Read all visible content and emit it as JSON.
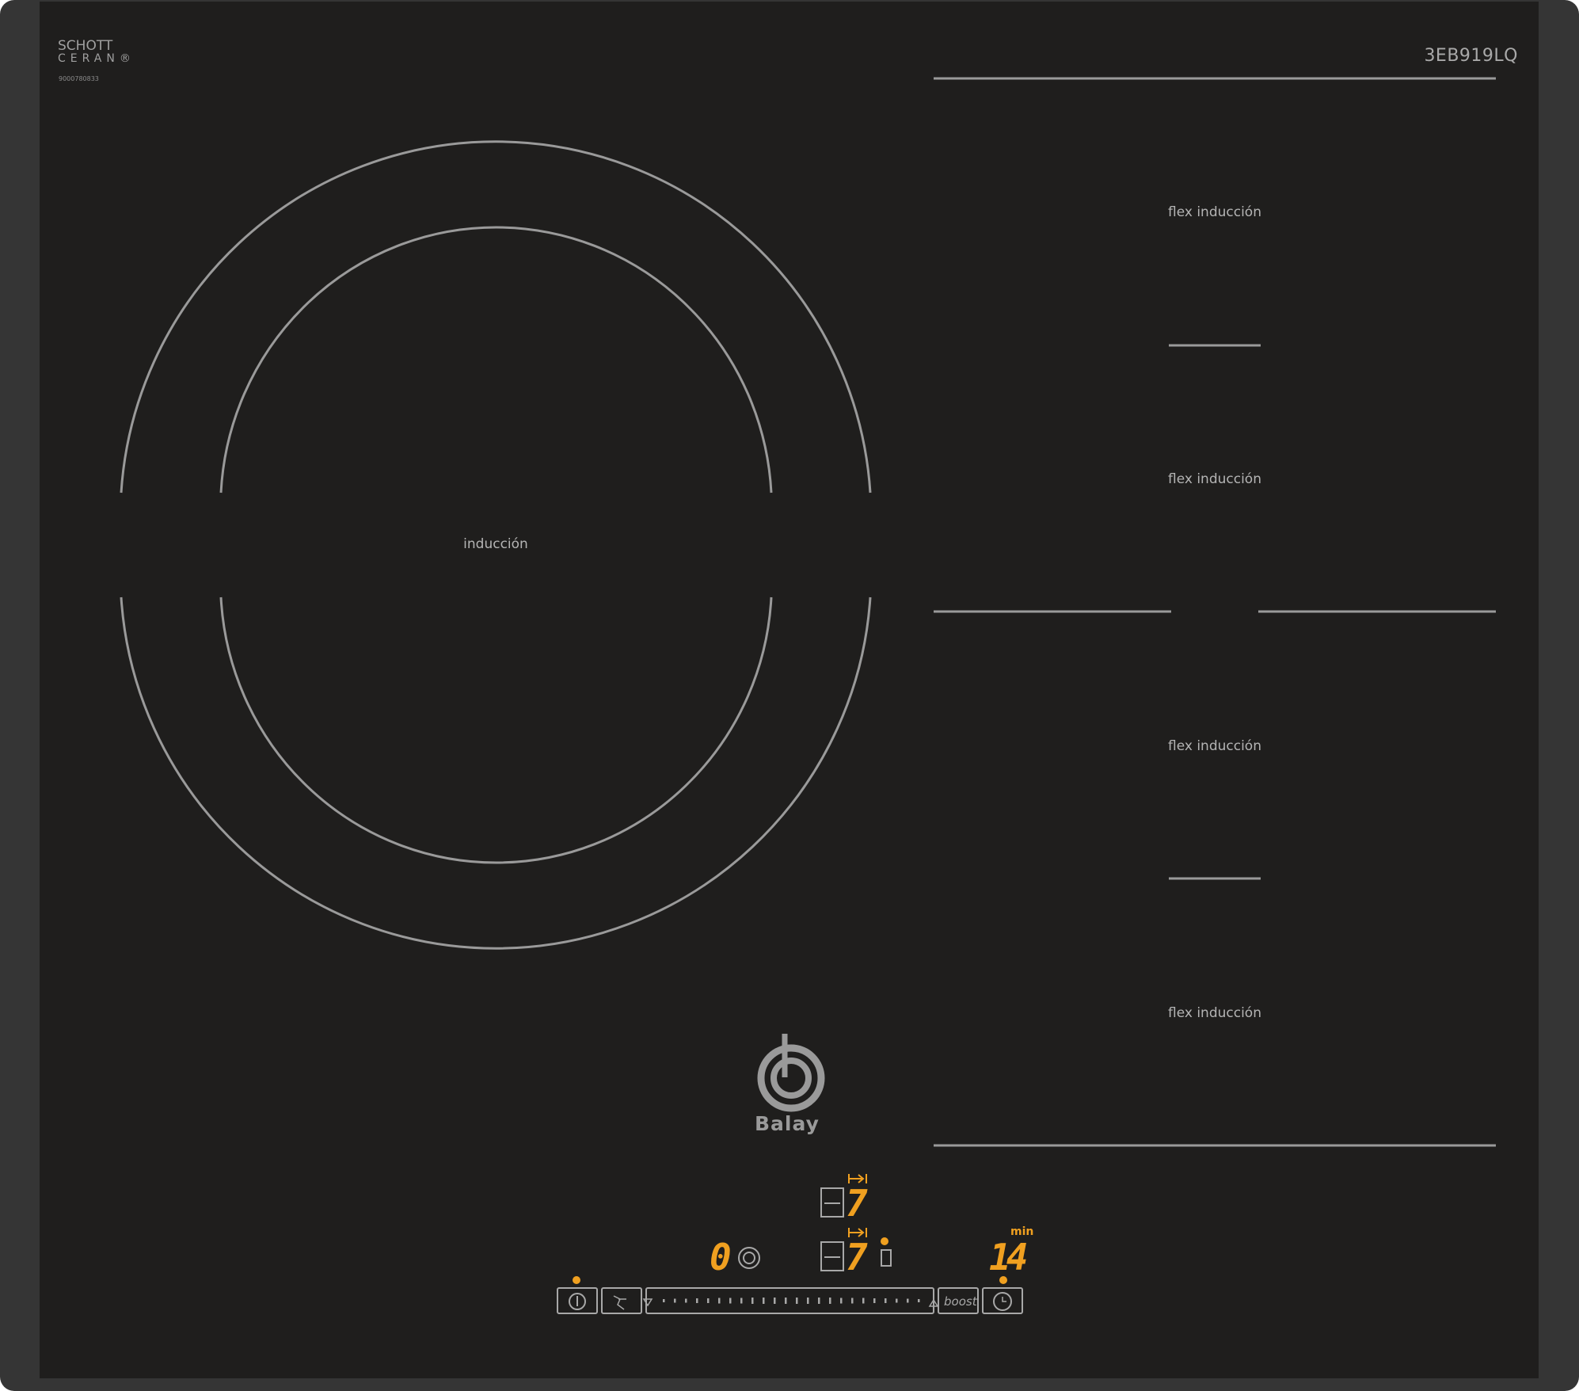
{
  "hob": {
    "manufacturer_mark": {
      "line1": "SCHOTT",
      "line2": "CERAN",
      "registered": "®",
      "serial": "9000780833"
    },
    "model": "3EB919LQ",
    "brand": "Balay",
    "zones": {
      "induction_label": "inducción",
      "flex_labels": [
        "flex inducción",
        "flex inducción",
        "flex inducción",
        "flex inducción"
      ]
    },
    "controls": {
      "power_level_left": "0",
      "flex_top_level": "7",
      "flex_bottom_level": "7",
      "timer_value": "14",
      "timer_unit": "min",
      "boost_label": "boost"
    },
    "colors": {
      "glass": "#1f1e1d",
      "frame": "#353535",
      "lines": "#9a9a9a",
      "display": "#f0a020"
    }
  }
}
